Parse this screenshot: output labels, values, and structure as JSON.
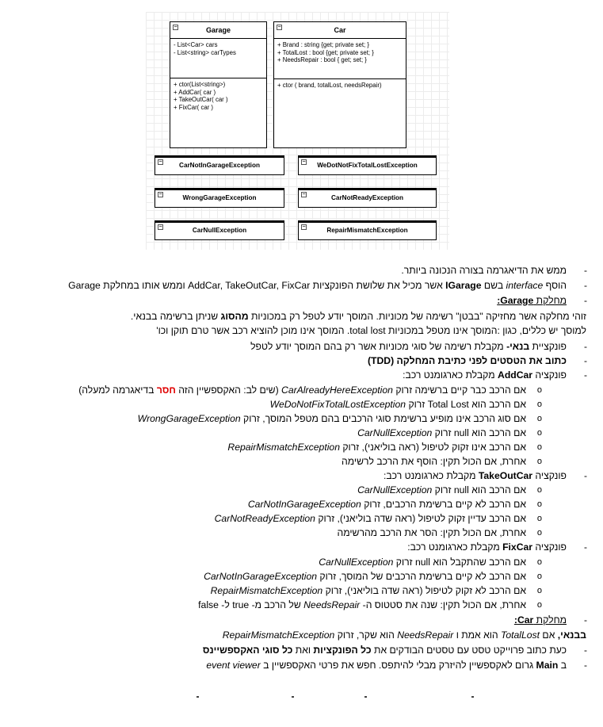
{
  "diagram": {
    "garage": {
      "title": "Garage",
      "fields": "- List<Car> cars\n- List<string> carTypes",
      "methods": "+ ctor(List<string>)\n+ AddCar( car )\n+ TakeOutCar( car )\n+ FixCar( car )"
    },
    "car": {
      "title": "Car",
      "fields": "+ Brand : string {get; private set; }\n+ TotalLost : bool {get; private set; }\n+ NeedsRepair : bool { get; set; }",
      "methods": "+ ctor ( brand, totalLost, needsRepair)"
    },
    "exceptions": [
      "CarNotInGarageException",
      "WeDotNotFixTotalLostException",
      "WrongGarageException",
      "CarNotReadyException",
      "CarNullException",
      "RepairMismatchException"
    ],
    "collapse_symbol": "⊟"
  },
  "text": {
    "dash": "-",
    "circle": "o",
    "l01": "ממש את הדיאגרמה בצורה הנכונה ביותר.",
    "l02a": "הוסף ",
    "l02b": "interface",
    "l02c": " בשם ",
    "l02d": "IGarage",
    "l02e": " אשר מכיל את שלושת הפונקציות AddCar, TakeOutCar, FixCar וממש אותו במחלקת Garage",
    "l03a": "מחלקת ",
    "l03b": "Garage:",
    "l04a": "זוהי מחלקה אשר מחזיקה \"בבטן\" רשימה של מכוניות. המוסך יודע לטפל רק במכוניות ",
    "l04b": "מהסוג",
    "l04c": " שניתן ברשימה בבנאי.",
    "l05": "למוסך יש כללים, כגון :המוסך אינו מטפל במכוניות total lost. המוסך אינו מוכן להוציא רכב אשר טרם תוקן וכו'",
    "l06a": "פונקציית ",
    "l06b": "בנאי-",
    "l06c": " מקבלת רשימה של סוגי מכוניות אשר רק בהם המוסך יודע לטפל",
    "l07": "כתוב את הטסטים לפני כתיבת המחלקה (TDD)",
    "l08a": "פונקציה ",
    "l08b": "AddCar",
    "l08c": " מקבלת כארגומנט רכב:",
    "l09a": "אם הרכב כבר קיים ברשימה זרוק ",
    "l09b": "CarAlreadyHereException",
    "l09c": " (שים לב: האקספשיין הזה ",
    "l09d": "חסר",
    "l09e": " בדיאגרמה למעלה)",
    "l10a": "אם הרכב הוא Total Lost זרוק ",
    "l10b": "WeDoNotFixTotalLostException",
    "l11a": "אם סוג הרכב אינו מופיע ברשימת סוגי הרכבים בהם מטפל המוסך, זרוק ",
    "l11b": "WrongGarageException",
    "l12a": "אם הרכב הוא null זרוק ",
    "l12b": "CarNullException",
    "l13a": "אם הרכב אינו זקוק לטיפול (ראה בוליאני), זרוק ",
    "l13b": "RepairMismatchException",
    "l14": "אחרת, אם הכול תקין: הוסף את הרכב לרשימה",
    "l15a": "פונקציה ",
    "l15b": "TakeOutCar",
    "l15c": " מקבלת כארגומנט רכב:",
    "l16a": "אם הרכב הוא null זרוק ",
    "l16b": "CarNullException",
    "l17a": "אם הרכב לא קיים ברשימת הרכבים, זרוק ",
    "l17b": "CarNotInGarageException",
    "l18a": "אם הרכב עדיין זקוק לטיפול (ראה שדה בוליאני), זרוק ",
    "l18b": "CarNotReadyException",
    "l19": "אחרת, אם הכול תקין: הסר את הרכב מהרשימה",
    "l20a": "פונקציה ",
    "l20b": "FixCar",
    "l20c": " מקבלת כארגומנט רכב:",
    "l21a": "אם הרכב שהתקבל הוא null זרוק ",
    "l21b": "CarNullException",
    "l22a": "אם הרכב לא קיים ברשימת הרכבים של המוסך, זרוק ",
    "l22b": "CarNotInGarageException",
    "l23a": "אם הרכב לא זקוק לטיפול (ראה שדה בוליאני), זרוק ",
    "l23b": "RepairMismatchException",
    "l24a": "אחרת, אם הכול תקין: שנה את סטטוס ה- ",
    "l24b": "NeedsRepair",
    "l24c": " של הרכב מ- true ל- false",
    "l25a": "מחלקת ",
    "l25b": "Car:",
    "l26a": "בבנאי,",
    "l26b": " אם ",
    "l26c": "TotalLost",
    "l26d": " הוא אמת ו ",
    "l26e": "NeedsRepair",
    "l26f": " הוא שקר, זרוק ",
    "l26g": "RepairMismatchException",
    "l27a": "כעת כתוב פרוייקט טסט עם טסטים הבודקים את ",
    "l27b": "כל הפונקציות",
    "l27c": " ואת ",
    "l27d": "כל סוגי האקספשיינס",
    "l28a": "ב ",
    "l28b": "Main",
    "l28c": " גרום לאקספשיין להיזרק מבלי להיתפס. חפש את פרטי האקספשיין ב ",
    "l28d": "event viewer"
  }
}
